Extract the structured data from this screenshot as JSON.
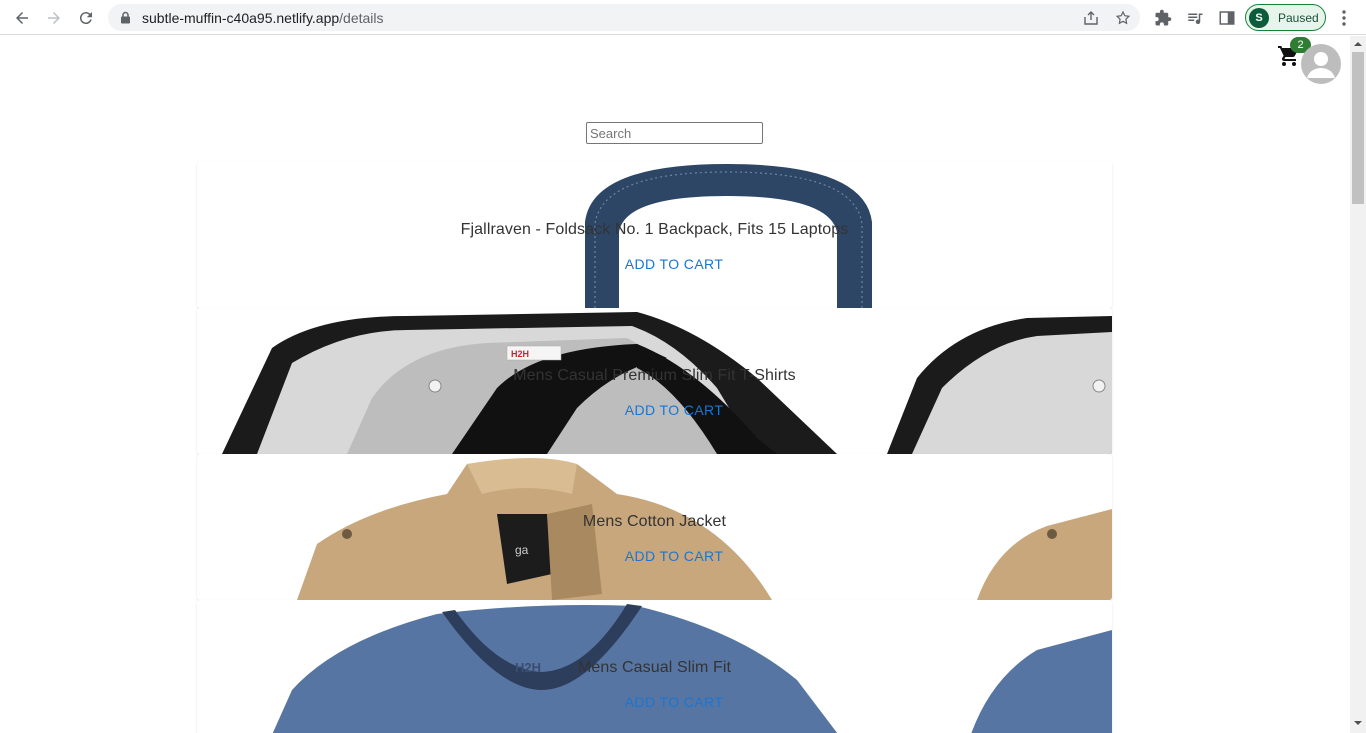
{
  "browser": {
    "url_host": "subtle-muffin-c40a95.netlify.app",
    "url_path": "/details",
    "profile_initial": "S",
    "profile_status": "Paused"
  },
  "header": {
    "cart_count": "2"
  },
  "search": {
    "placeholder": "Search",
    "value": ""
  },
  "products": [
    {
      "title": "Fjallraven - Foldsack No. 1 Backpack, Fits 15 Laptops",
      "button": "ADD TO CART"
    },
    {
      "title": "Mens Casual Premium Slim Fit T-Shirts",
      "button": "ADD TO CART"
    },
    {
      "title": "Mens Cotton Jacket",
      "button": "ADD TO CART"
    },
    {
      "title": "Mens Casual Slim Fit",
      "button": "ADD TO CART"
    }
  ],
  "colors": {
    "accent": "#1976d2",
    "badge": "#2e7d32"
  },
  "icons": [
    "back-icon",
    "forward-icon",
    "reload-icon",
    "lock-icon",
    "share-icon",
    "star-icon",
    "extensions-icon",
    "media-icon",
    "sidepanel-icon",
    "menu-icon",
    "cart-icon",
    "account-icon"
  ]
}
